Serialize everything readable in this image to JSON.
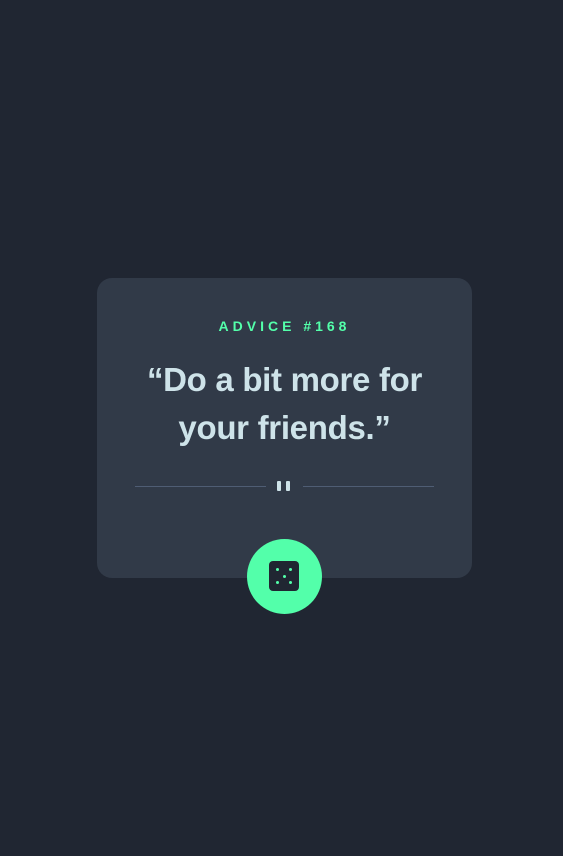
{
  "card": {
    "advice_label": "ADVICE #168",
    "quote": "“Do a bit more for your friends.”"
  },
  "dice_button": {
    "icon": "dice-icon"
  },
  "colors": {
    "background": "#202632",
    "card": "#313A48",
    "accent": "#53FFAA",
    "text": "#CEE3E9",
    "divider": "#4F5D74"
  }
}
